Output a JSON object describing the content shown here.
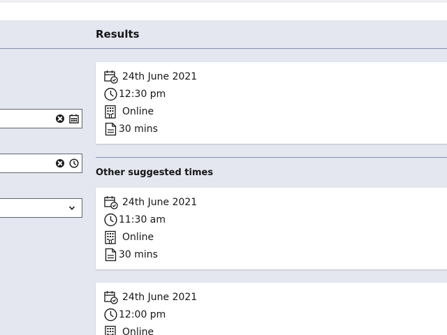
{
  "results": {
    "heading": "Results",
    "primary": {
      "date": "24th June 2021",
      "time": "12:30 pm",
      "location": "Online",
      "duration": "30 mins"
    }
  },
  "other": {
    "heading": "Other suggested times",
    "slots": [
      {
        "date": "24th June 2021",
        "time": "11:30 am",
        "location": "Online",
        "duration": "30 mins"
      },
      {
        "date": "24th June 2021",
        "time": "12:00 pm",
        "location": "Online"
      }
    ]
  },
  "form": {
    "date_field": {
      "value": ""
    },
    "time_field": {
      "value": ""
    },
    "select_field": {
      "value": ""
    }
  },
  "icons": {
    "date": "calendar-check-icon",
    "time": "clock-icon",
    "location": "building-icon",
    "duration": "document-icon",
    "clear": "clear-circle-icon",
    "calendar": "calendar-icon",
    "chevron": "chevron-down-icon"
  },
  "colors": {
    "page_bg": "#e4e7ef",
    "card_bg": "#ffffff",
    "divider": "#7f8fb3",
    "text": "#161616"
  }
}
